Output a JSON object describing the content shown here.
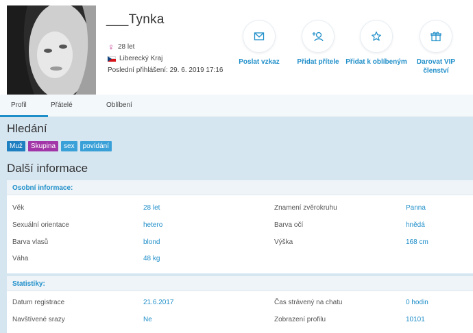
{
  "profile": {
    "username": "___Tynka",
    "age": "28 let",
    "region": "Liberecký Kraj",
    "last_login": "Poslední přihlášení: 29. 6. 2019 17:16"
  },
  "actions": [
    {
      "label": "Poslat vzkaz",
      "icon": "envelope-icon"
    },
    {
      "label": "Přidat přítele",
      "icon": "add-friend-icon"
    },
    {
      "label": "Přidat k oblíbeným",
      "icon": "star-icon"
    },
    {
      "label": "Darovat VIP členství",
      "icon": "gift-icon"
    }
  ],
  "tabs": [
    "Profil",
    "Přátelé",
    "Oblíbení"
  ],
  "search": {
    "title": "Hledání",
    "tags": [
      {
        "label": "Muž",
        "color": "#1e7fc1"
      },
      {
        "label": "Skupina",
        "color": "#a236a8"
      },
      {
        "label": "sex",
        "color": "#3aa0d8"
      },
      {
        "label": "povídání",
        "color": "#3aa0d8"
      }
    ]
  },
  "more_info_title": "Další informace",
  "personal": {
    "title": "Osobní informace:",
    "rows": [
      [
        {
          "label": "Věk",
          "value": "28 let"
        },
        {
          "label": "Znamení zvěrokruhu",
          "value": "Panna"
        }
      ],
      [
        {
          "label": "Sexuální orientace",
          "value": "hetero"
        },
        {
          "label": "Barva očí",
          "value": "hnědá"
        }
      ],
      [
        {
          "label": "Barva vlasů",
          "value": "blond"
        },
        {
          "label": "Výška",
          "value": "168 cm"
        }
      ],
      [
        {
          "label": "Váha",
          "value": "48 kg"
        },
        {
          "label": "",
          "value": ""
        }
      ]
    ]
  },
  "stats": {
    "title": "Statistiky:",
    "rows": [
      [
        {
          "label": "Datum registrace",
          "value": "21.6.2017"
        },
        {
          "label": "Čas strávený na chatu",
          "value": "0 hodin"
        }
      ],
      [
        {
          "label": "Navštívené srazy",
          "value": "Ne"
        },
        {
          "label": "Zobrazení profilu",
          "value": "10101"
        }
      ]
    ]
  },
  "colors": {
    "accent": "#1e8ec9",
    "background": "#d6e6f1"
  }
}
